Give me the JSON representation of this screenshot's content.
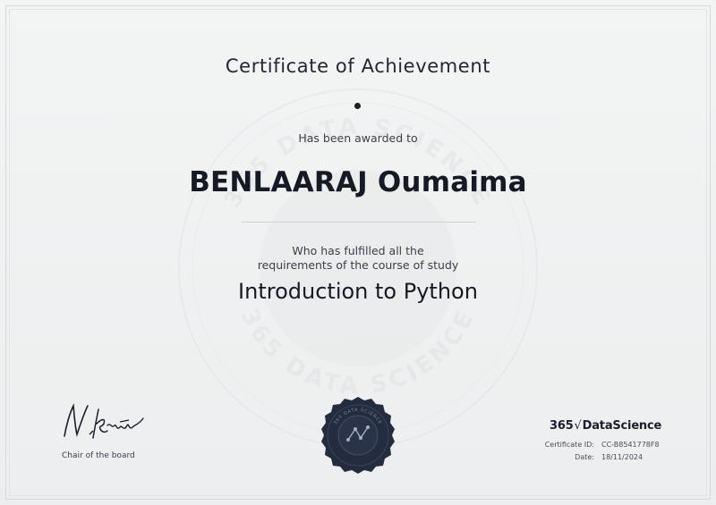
{
  "certificate": {
    "title": "Certificate of Achievement",
    "awarded_text": "Has been awarded to",
    "recipient": "BENLAARAJ Oumaima",
    "fulfilled_line1": "Who has fulfilled all the",
    "fulfilled_line2": "requirements of the course of study",
    "course": "Introduction to Python"
  },
  "signature": {
    "role": "Chair of the board"
  },
  "brand": {
    "number": "365",
    "sqrt": "√",
    "name": "DataScience"
  },
  "meta": {
    "id_label": "Certificate ID:",
    "id_value": "CC-B8541778F8",
    "date_label": "Date:",
    "date_value": "18/11/2024"
  },
  "watermark_text": "365 DATA SCIENCE",
  "colors": {
    "ink": "#1a1f2b",
    "seal": "#242c3f"
  }
}
